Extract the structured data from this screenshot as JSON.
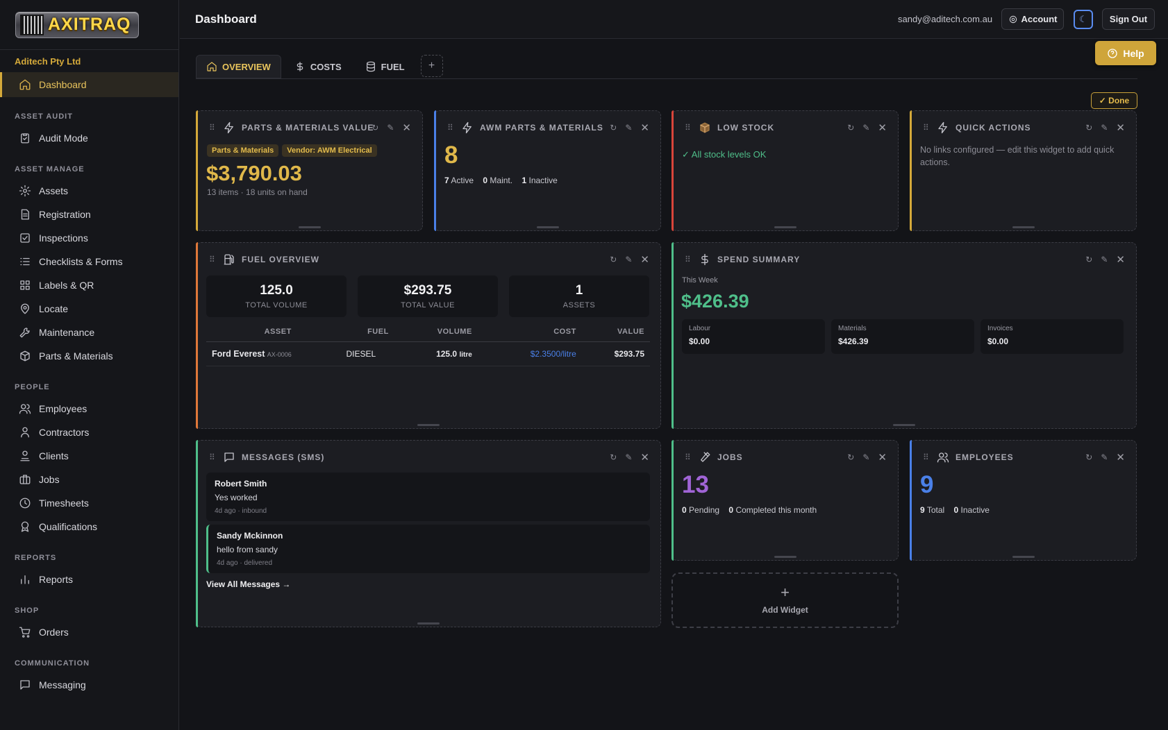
{
  "app": {
    "logo_text": "AXITRAQ",
    "company": "Aditech Pty Ltd"
  },
  "sidebar": {
    "dashboard": "Dashboard",
    "sections": {
      "asset_audit": "ASSET AUDIT",
      "asset_manage": "ASSET MANAGE",
      "people": "PEOPLE",
      "reports": "REPORTS",
      "shop": "SHOP",
      "communication": "COMMUNICATION"
    },
    "items": {
      "audit_mode": "Audit Mode",
      "assets": "Assets",
      "registration": "Registration",
      "inspections": "Inspections",
      "checklists": "Checklists & Forms",
      "labels": "Labels & QR",
      "locate": "Locate",
      "maintenance": "Maintenance",
      "parts": "Parts & Materials",
      "employees": "Employees",
      "contractors": "Contractors",
      "clients": "Clients",
      "jobs": "Jobs",
      "timesheets": "Timesheets",
      "qualifications": "Qualifications",
      "reports": "Reports",
      "orders": "Orders",
      "messaging": "Messaging"
    }
  },
  "header": {
    "title": "Dashboard",
    "email": "sandy@aditech.com.au",
    "account": "Account",
    "sign_out": "Sign Out",
    "help": "Help",
    "theme_icon": "☾"
  },
  "tabs": {
    "overview": "OVERVIEW",
    "costs": "COSTS",
    "fuel": "FUEL",
    "add": "+"
  },
  "done": "✓ Done",
  "widgets": {
    "parts_value": {
      "title": "PARTS & MATERIALS VALUE",
      "tag1": "Parts & Materials",
      "tag2": "Vendor: AWM Electrical",
      "value": "$3,790.03",
      "sub": "13 items · 18 units on hand"
    },
    "awm": {
      "title": "AWM PARTS & MATERIALS",
      "value": "8",
      "active_n": "7",
      "active_l": "Active",
      "maint_n": "0",
      "maint_l": "Maint.",
      "inactive_n": "1",
      "inactive_l": "Inactive"
    },
    "low_stock": {
      "title": "LOW STOCK",
      "status": "✓ All stock levels OK"
    },
    "quick": {
      "title": "QUICK ACTIONS",
      "text": "No links configured — edit this widget to add quick actions."
    },
    "fuel": {
      "title": "FUEL OVERVIEW",
      "stats": [
        {
          "value": "125.0",
          "label": "TOTAL VOLUME"
        },
        {
          "value": "$293.75",
          "label": "TOTAL VALUE"
        },
        {
          "value": "1",
          "label": "ASSETS"
        }
      ],
      "columns": [
        "ASSET",
        "FUEL",
        "VOLUME",
        "COST",
        "VALUE"
      ],
      "rows": [
        {
          "asset": "Ford Everest",
          "asset_id": "AX-0006",
          "fuel": "DIESEL",
          "volume": "125.0",
          "unit": "litre",
          "cost": "$2.3500/litre",
          "value": "$293.75"
        }
      ]
    },
    "spend": {
      "title": "SPEND SUMMARY",
      "period": "This Week",
      "value": "$426.39",
      "boxes": [
        {
          "label": "Labour",
          "value": "$0.00"
        },
        {
          "label": "Materials",
          "value": "$426.39"
        },
        {
          "label": "Invoices",
          "value": "$0.00"
        }
      ]
    },
    "messages": {
      "title": "MESSAGES (SMS)",
      "items": [
        {
          "name": "Robert Smith",
          "text": "Yes worked",
          "meta": "4d ago · inbound"
        },
        {
          "name": "Sandy Mckinnon",
          "text": "hello from sandy",
          "meta": "4d ago · delivered"
        }
      ],
      "view_all": "View All Messages →"
    },
    "jobs": {
      "title": "JOBS",
      "value": "13",
      "pending_n": "0",
      "pending_l": "Pending",
      "completed_n": "0",
      "completed_l": "Completed this month"
    },
    "employees": {
      "title": "EMPLOYEES",
      "value": "9",
      "total_n": "9",
      "total_l": "Total",
      "inactive_n": "0",
      "inactive_l": "Inactive"
    },
    "add_widget": {
      "plus": "+",
      "label": "Add Widget"
    },
    "controls": {
      "refresh": "↻",
      "edit": "✎",
      "close": "✕",
      "drag": "⠿"
    }
  },
  "colors": {
    "accent": "#d4a93a",
    "blue": "#4a80e8",
    "red": "#d9453a",
    "green": "#4fbf8a",
    "purple": "#a064d6",
    "orange": "#e0783a"
  }
}
